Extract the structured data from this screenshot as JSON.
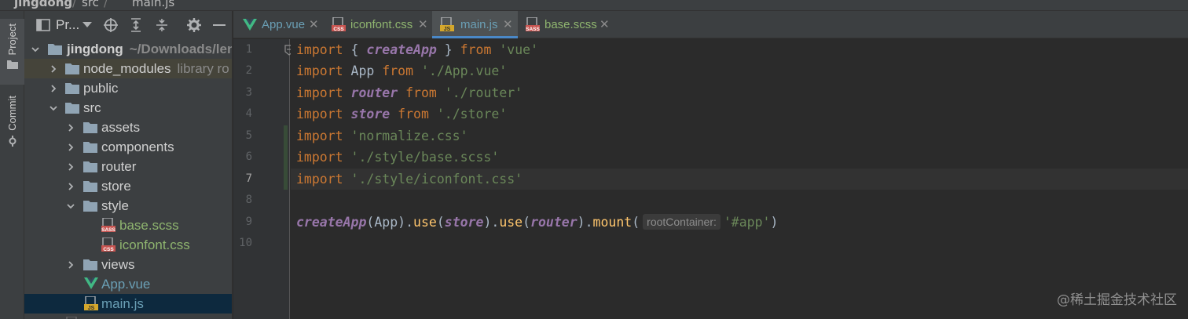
{
  "breadcrumb": [
    "jingdong",
    "src",
    "main.js"
  ],
  "toolstrip": {
    "project_label": "Project",
    "commit_label": "Commit"
  },
  "project_panel": {
    "title": "Pr...",
    "tree": [
      {
        "label": "jingdong",
        "sub": "~/Downloads/leng",
        "kind": "folder",
        "depth": 0,
        "expanded": true
      },
      {
        "label": "node_modules",
        "sub": "library ro",
        "kind": "folder-excluded",
        "depth": 1,
        "expanded": false
      },
      {
        "label": "public",
        "sub": "",
        "kind": "folder",
        "depth": 1,
        "expanded": false
      },
      {
        "label": "src",
        "sub": "",
        "kind": "folder",
        "depth": 1,
        "expanded": true
      },
      {
        "label": "assets",
        "sub": "",
        "kind": "folder",
        "depth": 2,
        "expanded": false
      },
      {
        "label": "components",
        "sub": "",
        "kind": "folder",
        "depth": 2,
        "expanded": false
      },
      {
        "label": "router",
        "sub": "",
        "kind": "folder",
        "depth": 2,
        "expanded": false
      },
      {
        "label": "store",
        "sub": "",
        "kind": "folder",
        "depth": 2,
        "expanded": false
      },
      {
        "label": "style",
        "sub": "",
        "kind": "folder",
        "depth": 2,
        "expanded": true
      },
      {
        "label": "base.scss",
        "sub": "",
        "kind": "sass",
        "depth": 3
      },
      {
        "label": "iconfont.css",
        "sub": "",
        "kind": "css",
        "depth": 3
      },
      {
        "label": "views",
        "sub": "",
        "kind": "folder",
        "depth": 2,
        "expanded": false
      },
      {
        "label": "App.vue",
        "sub": "",
        "kind": "vue",
        "depth": 2
      },
      {
        "label": "main.js",
        "sub": "",
        "kind": "js",
        "depth": 2,
        "selected": true
      }
    ]
  },
  "tabs": [
    {
      "label": "App.vue",
      "kind": "vue",
      "color": "#6a9fb5"
    },
    {
      "label": "iconfont.css",
      "kind": "css",
      "color": "#6a8759"
    },
    {
      "label": "main.js",
      "kind": "js",
      "color": "#6a9fb5",
      "active": true
    },
    {
      "label": "base.scss",
      "kind": "sass",
      "color": "#6a8759"
    }
  ],
  "editor": {
    "line_numbers": [
      "1",
      "2",
      "3",
      "4",
      "5",
      "6",
      "7",
      "8",
      "9",
      "10"
    ],
    "current_line": "7",
    "hint_label": "rootContainer:",
    "code": {
      "l1": {
        "kw1": "import",
        "b1": " { ",
        "fn": "createApp",
        "b2": " } ",
        "kw2": "from",
        "sp": " ",
        "str": "'vue'"
      },
      "l2": {
        "kw1": "import",
        "plain": " App ",
        "kw2": "from",
        "sp": " ",
        "str": "'./App.vue'"
      },
      "l3": {
        "kw1": "import",
        "sp1": " ",
        "var": "router",
        "sp2": " ",
        "kw2": "from",
        "sp3": " ",
        "str": "'./router'"
      },
      "l4": {
        "kw1": "import",
        "sp1": " ",
        "var": "store",
        "sp2": " ",
        "kw2": "from",
        "sp3": " ",
        "str": "'./store'"
      },
      "l5": {
        "kw1": "import",
        "sp": " ",
        "str": "'normalize.css'"
      },
      "l6": {
        "kw1": "import",
        "sp": " ",
        "str": "'./style/base.scss'"
      },
      "l7": {
        "kw1": "import",
        "sp": " ",
        "str": "'./style/iconfont.css'"
      },
      "l9": {
        "fn": "createApp",
        "p1": "(App).",
        "m1": "use",
        "p2": "(",
        "v1": "store",
        "p3": ").",
        "m2": "use",
        "p4": "(",
        "v2": "router",
        "p5": ").",
        "m3": "mount",
        "p6": "(",
        "str": "'#app'",
        "p7": ")"
      }
    }
  },
  "watermark": "@稀土掘金技术社区",
  "colors": {
    "accent": "#4a88c7",
    "keyword": "#cc7832",
    "string": "#6a8759",
    "field": "#9876aa",
    "method": "#ffc66d"
  }
}
